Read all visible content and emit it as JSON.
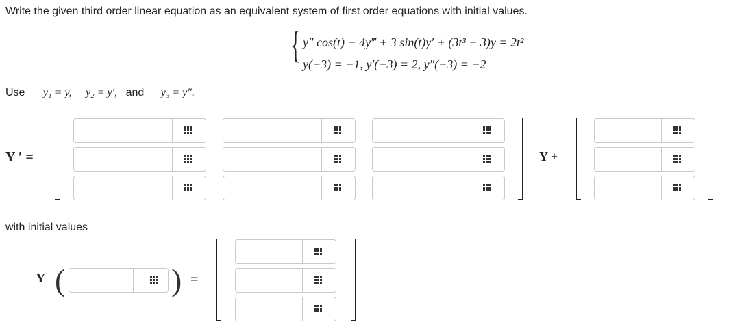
{
  "prompt": "Write the given third order linear equation as an equivalent system of first order equations with initial values.",
  "system": {
    "line1": "y″ cos(t) − 4y‴ + 3 sin(t)y′ + (3t³ + 3)y = 2t²",
    "line2": "y(−3) = −1,   y′(−3) = 2,   y″(−3) = −2"
  },
  "use": {
    "label": "Use",
    "y1": "y₁ = y,",
    "y2": "y₂ = y′,",
    "and": "and",
    "y3": "y₃ = y″."
  },
  "equation": {
    "lhs": "Y ′ =",
    "mid": "Y +"
  },
  "initial": {
    "label": "with initial values",
    "y_label": "Y",
    "eq": "="
  },
  "matrix_a": [
    [
      "",
      "",
      ""
    ],
    [
      "",
      "",
      ""
    ],
    [
      "",
      "",
      ""
    ]
  ],
  "vector_b": [
    "",
    "",
    ""
  ],
  "initial_arg": "",
  "initial_vector": [
    "",
    "",
    ""
  ],
  "icons": {
    "input_tool": "matrix-grid-icon"
  }
}
